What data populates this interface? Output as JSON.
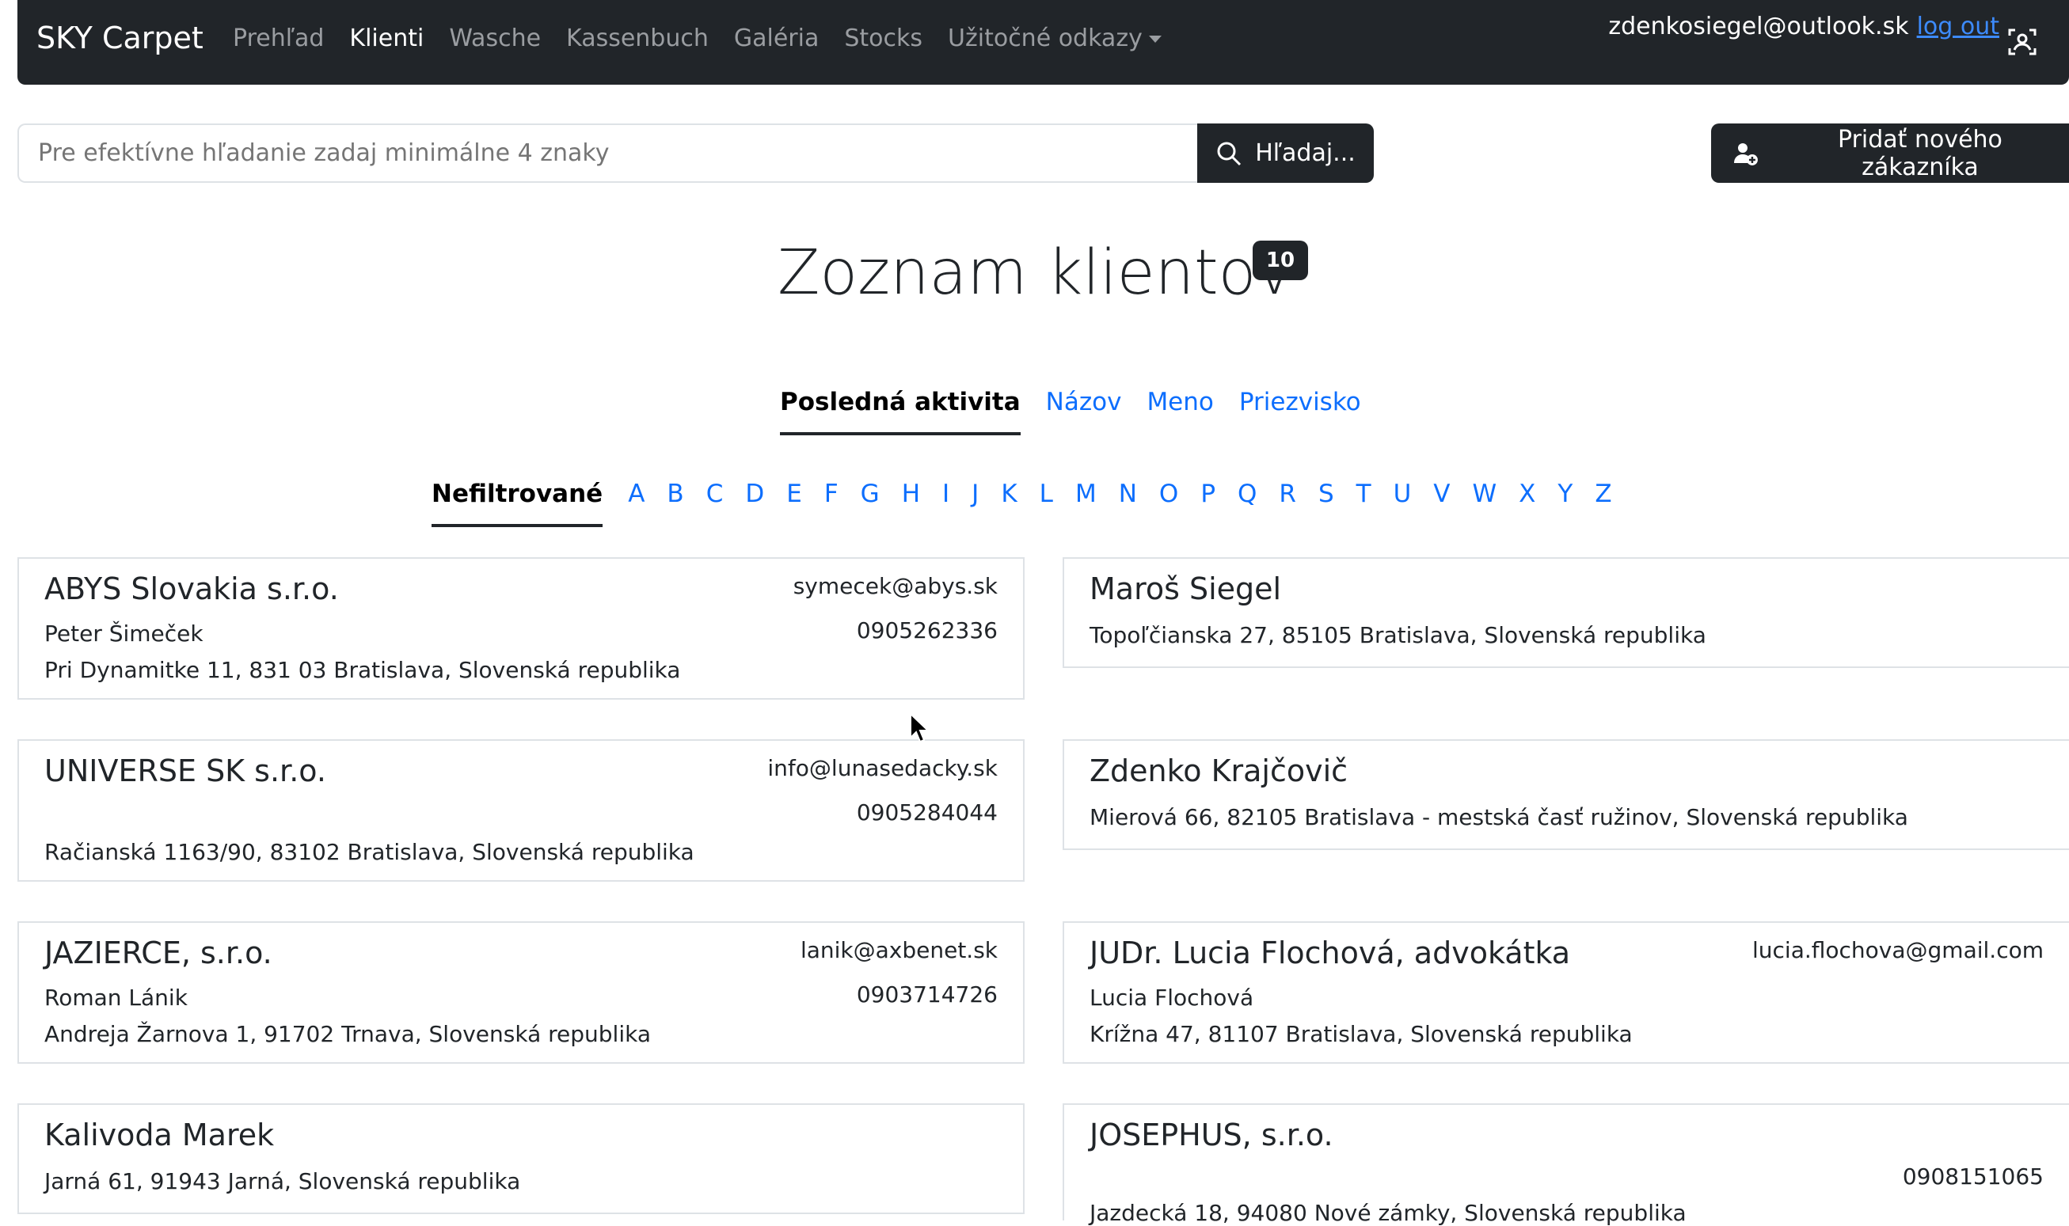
{
  "navbar": {
    "brand": "SKY Carpet",
    "items": [
      {
        "label": "Prehľad",
        "active": false
      },
      {
        "label": "Klienti",
        "active": true
      },
      {
        "label": "Wasche",
        "active": false
      },
      {
        "label": "Kassenbuch",
        "active": false
      },
      {
        "label": "Galéria",
        "active": false
      },
      {
        "label": "Stocks",
        "active": false
      },
      {
        "label": "Užitočné odkazy",
        "active": false
      }
    ],
    "user_email": "zdenkosiegel@outlook.sk",
    "logout": "log out"
  },
  "search": {
    "placeholder": "Pre efektívne hľadanie zadaj minimálne 4 znaky",
    "button": "Hľadaj..."
  },
  "add_customer": "Pridať nového zákazníka",
  "page": {
    "title": "Zoznam klientov",
    "count": "10"
  },
  "sort_tabs": [
    "Posledná aktivita",
    "Názov",
    "Meno",
    "Priezvisko"
  ],
  "alpha_filter": {
    "all": "Nefiltrované",
    "letters": [
      "A",
      "B",
      "C",
      "D",
      "E",
      "F",
      "G",
      "H",
      "I",
      "J",
      "K",
      "L",
      "M",
      "N",
      "O",
      "P",
      "Q",
      "R",
      "S",
      "T",
      "U",
      "V",
      "W",
      "X",
      "Y",
      "Z"
    ]
  },
  "clients": [
    {
      "name": "ABYS Slovakia s.r.o.",
      "person": "Peter Šimeček",
      "address": "Pri Dynamitke 11, 831 03 Bratislava, Slovenská republika",
      "email": "symecek@abys.sk",
      "phone": "0905262336"
    },
    {
      "name": "Maroš Siegel",
      "person": "",
      "address": "Topoľčianska 27, 85105 Bratislava, Slovenská republika",
      "email": "",
      "phone": ""
    },
    {
      "name": "UNIVERSE SK s.r.o.",
      "person": "",
      "address": "Račianská 1163/90, 83102 Bratislava, Slovenská republika",
      "email": "info@lunasedacky.sk",
      "phone": "0905284044"
    },
    {
      "name": "Zdenko Krajčovič",
      "person": "",
      "address": "Mierová 66, 82105 Bratislava - mestská časť ružinov, Slovenská republika",
      "email": "",
      "phone": ""
    },
    {
      "name": "JAZIERCE, s.r.o.",
      "person": "Roman Lánik",
      "address": "Andreja Žarnova 1, 91702 Trnava, Slovenská republika",
      "email": "lanik@axbenet.sk",
      "phone": "0903714726"
    },
    {
      "name": "JUDr. Lucia Flochová, advokátka",
      "person": "Lucia Flochová",
      "address": "Krížna 47, 81107 Bratislava, Slovenská republika",
      "email": "lucia.flochova@gmail.com",
      "phone": ""
    },
    {
      "name": "Kalivoda Marek",
      "person": "",
      "address": "Jarná 61, 91943 Jarná, Slovenská republika",
      "email": "",
      "phone": ""
    },
    {
      "name": "JOSEPHUS, s.r.o.",
      "person": "",
      "address": "Jazdecká 18, 94080 Nové zámky, Slovenská republika",
      "email": "",
      "phone": "0908151065"
    }
  ]
}
